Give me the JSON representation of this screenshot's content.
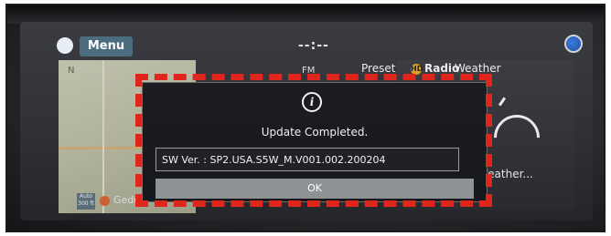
{
  "header": {
    "menu_label": "Menu",
    "clock": "--:--"
  },
  "tabs": {
    "fm": "FM",
    "preset": "Preset",
    "radio": "Radio",
    "weather": "Weather",
    "hd_badge": "HD"
  },
  "weather_widget": {
    "label": "Weather..."
  },
  "map": {
    "compass": "N",
    "scale_label": "Auto 300 ft",
    "location_label": "Gedu"
  },
  "popup": {
    "title": "Update Completed.",
    "version_text": "SW Ver. : SP2.USA.S5W_M.V001.002.200204",
    "ok_label": "OK"
  },
  "colors": {
    "annotation_red": "#e0261c",
    "ok_button": "#8e9294",
    "menu_button": "#4a6d80"
  },
  "icons": {
    "info": "info-icon",
    "sun": "sun-icon",
    "navigation": "navigation-icon"
  }
}
